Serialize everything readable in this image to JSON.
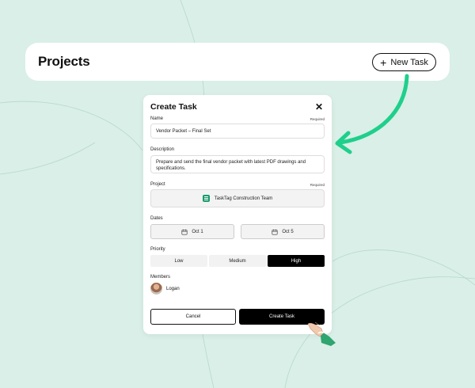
{
  "header": {
    "title": "Projects",
    "new_task_label": "New Task"
  },
  "modal": {
    "title": "Create Task",
    "name": {
      "label": "Name",
      "required": "Required",
      "value": "Vendor Packet – Final Set"
    },
    "description": {
      "label": "Description",
      "value": "Prepare and send the final vendor packet with latest PDF drawings and specifications."
    },
    "project": {
      "label": "Project",
      "required": "Required",
      "value": "TaskTag Construction Team"
    },
    "dates": {
      "label": "Dates",
      "start": "Oct 1",
      "end": "Oct 5"
    },
    "priority": {
      "label": "Priority",
      "options": [
        "Low",
        "Medium",
        "High"
      ],
      "selected": "High"
    },
    "members": {
      "label": "Members",
      "items": [
        {
          "name": "Logan"
        }
      ]
    },
    "cancel_label": "Cancel",
    "create_label": "Create Task"
  },
  "colors": {
    "background": "#d9efe7",
    "accent_arrow": "#1fcf8c",
    "project_icon": "#1a9b6c",
    "hand_sleeve": "#2fa56f"
  },
  "icons": [
    "search-icon",
    "plus-icon",
    "close-icon",
    "project-icon",
    "calendar-icon",
    "arrow-pointer",
    "hand-pointer"
  ]
}
